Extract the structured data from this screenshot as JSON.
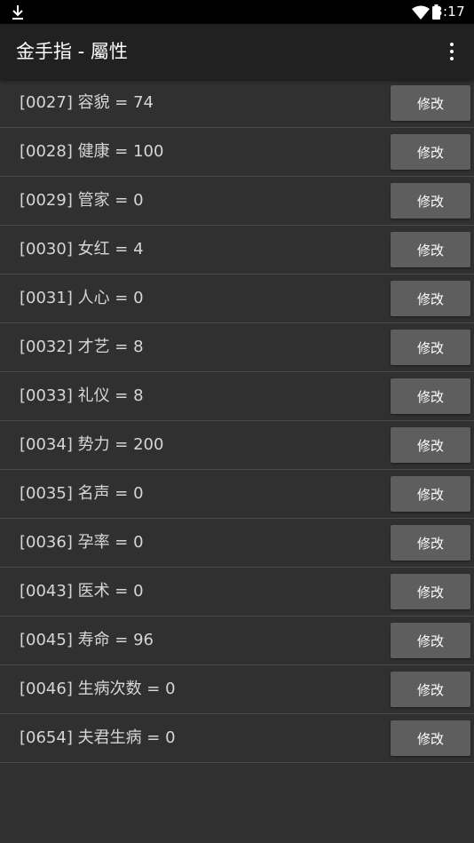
{
  "status_bar": {
    "time": "3:17",
    "icons": [
      "download-icon",
      "wifi-icon",
      "battery-icon"
    ]
  },
  "app_bar": {
    "title": "金手指 - 屬性",
    "menu_icon": "more-vert-icon"
  },
  "colors": {
    "background": "#303030",
    "app_bar": "#212121",
    "status_bar": "#000000",
    "button": "#5e5e5e",
    "divider": "#4a4a4a",
    "text": "#d6d6d6"
  },
  "attributes": [
    {
      "label": "[0027] 容貌 = 74",
      "button": "修改"
    },
    {
      "label": "[0028] 健康 = 100",
      "button": "修改"
    },
    {
      "label": "[0029] 管家 = 0",
      "button": "修改"
    },
    {
      "label": "[0030] 女红 = 4",
      "button": "修改"
    },
    {
      "label": "[0031] 人心 = 0",
      "button": "修改"
    },
    {
      "label": "[0032] 才艺 = 8",
      "button": "修改"
    },
    {
      "label": "[0033] 礼仪 = 8",
      "button": "修改"
    },
    {
      "label": "[0034] 势力 = 200",
      "button": "修改"
    },
    {
      "label": "[0035] 名声 = 0",
      "button": "修改"
    },
    {
      "label": "[0036] 孕率 = 0",
      "button": "修改"
    },
    {
      "label": "[0043] 医术 = 0",
      "button": "修改"
    },
    {
      "label": "[0045] 寿命 = 96",
      "button": "修改"
    },
    {
      "label": "[0046] 生病次数 = 0",
      "button": "修改"
    },
    {
      "label": "[0654] 夫君生病 = 0",
      "button": "修改"
    }
  ]
}
